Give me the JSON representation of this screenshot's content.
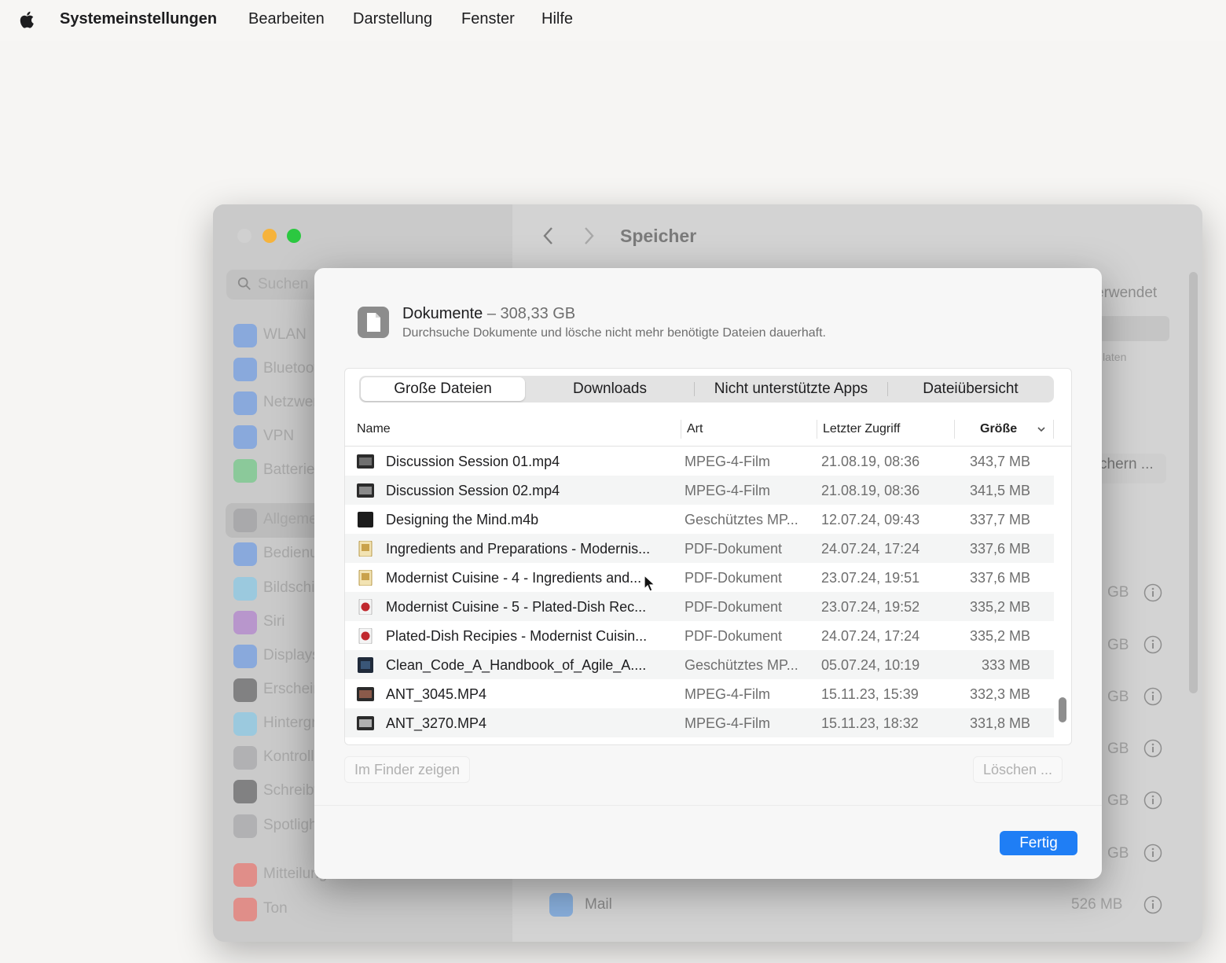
{
  "menubar": {
    "app_name": "Systemeinstellungen",
    "items": [
      "Bearbeiten",
      "Darstellung",
      "Fenster",
      "Hilfe"
    ]
  },
  "background_window": {
    "title": "Speicher",
    "search_placeholder": "Suchen",
    "sidebar_items": [
      "WLAN",
      "Bluetooth",
      "Netzwerk",
      "VPN",
      "Batterie",
      "Allgemein",
      "Bedienungshilfen",
      "Bildschirm",
      "Siri",
      "Displays",
      "Erscheinungsbild",
      "Hintergrund",
      "Kontrollzentrum",
      "Schreibtisch",
      "Spotlight",
      "Mitteilungen",
      "Ton"
    ],
    "right_fragments": {
      "used": "erwendet",
      "data": "laten",
      "button": "chern ...",
      "gb": "GB",
      "mail_label": "Mail",
      "mail_size": "526 MB"
    }
  },
  "dialog": {
    "title": "Dokumente",
    "size": "– 308,33 GB",
    "subtitle": "Durchsuche Dokumente und lösche nicht mehr benötigte Dateien dauerhaft.",
    "tabs": [
      "Große Dateien",
      "Downloads",
      "Nicht unterstützte Apps",
      "Dateiübersicht"
    ],
    "columns": {
      "name": "Name",
      "kind": "Art",
      "last_access": "Letzter Zugriff",
      "size": "Größe"
    },
    "rows": [
      {
        "name": "Discussion Session 01.mp4",
        "kind": "MPEG-4-Film",
        "date": "21.08.19, 08:36",
        "size": "343,7 MB",
        "icon": "video-icon"
      },
      {
        "name": "Discussion Session 02.mp4",
        "kind": "MPEG-4-Film",
        "date": "21.08.19, 08:36",
        "size": "341,5 MB",
        "icon": "video-icon"
      },
      {
        "name": "Designing the Mind.m4b",
        "kind": "Geschütztes MP...",
        "date": "12.07.24, 09:43",
        "size": "337,7 MB",
        "icon": "audiobook-icon"
      },
      {
        "name": "Ingredients and Preparations - Modernis...",
        "kind": "PDF-Dokument",
        "date": "24.07.24, 17:24",
        "size": "337,6 MB",
        "icon": "pdf-icon"
      },
      {
        "name": "Modernist Cuisine - 4 - Ingredients and...",
        "kind": "PDF-Dokument",
        "date": "23.07.24, 19:51",
        "size": "337,6 MB",
        "icon": "pdf-icon"
      },
      {
        "name": "Modernist Cuisine - 5 - Plated-Dish Rec...",
        "kind": "PDF-Dokument",
        "date": "23.07.24, 19:52",
        "size": "335,2 MB",
        "icon": "pdf-red-icon"
      },
      {
        "name": "Plated-Dish Recipies - Modernist Cuisin...",
        "kind": "PDF-Dokument",
        "date": "24.07.24, 17:24",
        "size": "335,2 MB",
        "icon": "pdf-red-icon"
      },
      {
        "name": "Clean_Code_A_Handbook_of_Agile_A....",
        "kind": "Geschütztes MP...",
        "date": "05.07.24, 10:19",
        "size": "333 MB",
        "icon": "audiobook-icon"
      },
      {
        "name": "ANT_3045.MP4",
        "kind": "MPEG-4-Film",
        "date": "15.11.23, 15:39",
        "size": "332,3 MB",
        "icon": "video-icon"
      },
      {
        "name": "ANT_3270.MP4",
        "kind": "MPEG-4-Film",
        "date": "15.11.23, 18:32",
        "size": "331,8 MB",
        "icon": "video-icon"
      }
    ],
    "buttons": {
      "show_in_finder": "Im Finder zeigen",
      "delete": "Löschen ...",
      "done": "Fertig"
    }
  },
  "colors": {
    "accent": "#1f7ef5",
    "close": "#d0d0d0",
    "minimize": "#f6b33c",
    "maximize": "#2bc840"
  }
}
